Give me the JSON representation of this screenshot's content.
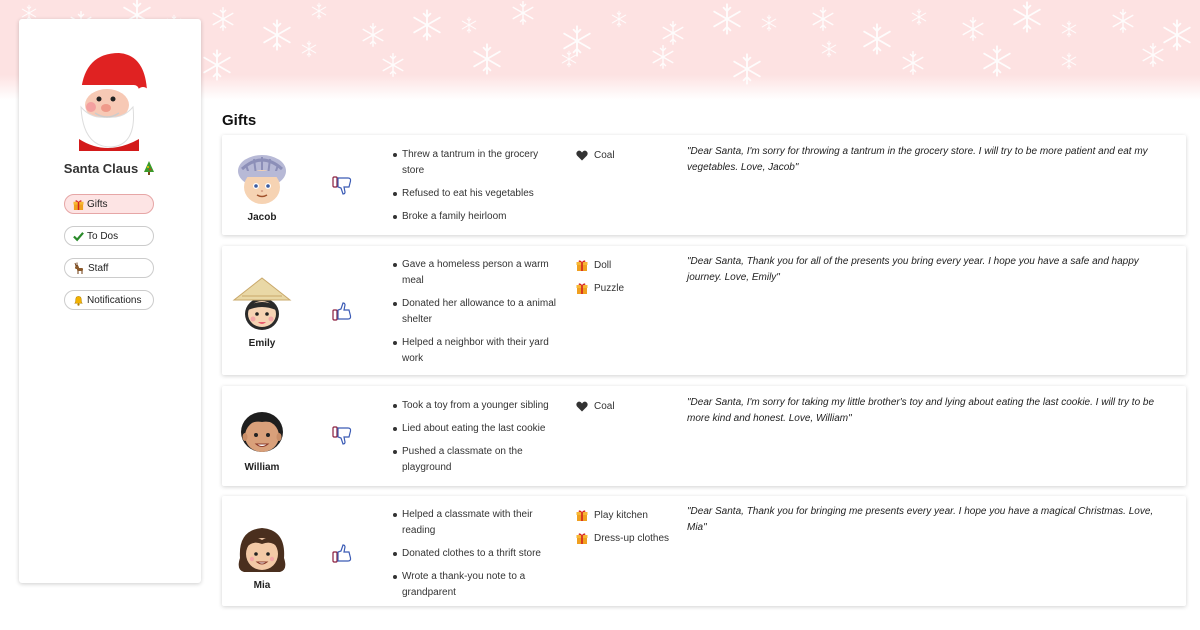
{
  "sidebar": {
    "profile_name": "Santa Claus",
    "avatar": "santa-avatar",
    "nav": [
      {
        "label": "Gifts",
        "icon": "gift-icon",
        "active": true
      },
      {
        "label": "To Dos",
        "icon": "check-icon",
        "active": false
      },
      {
        "label": "Staff",
        "icon": "reindeer-icon",
        "active": false
      },
      {
        "label": "Notifications",
        "icon": "bell-icon",
        "active": false
      }
    ]
  },
  "main": {
    "title": "Gifts",
    "children": [
      {
        "name": "Jacob",
        "rating": "thumbs-down",
        "deeds": [
          "Threw a tantrum in the grocery store",
          "Refused to eat his vegetables",
          "Broke a family heirloom"
        ],
        "gifts": [
          {
            "label": "Coal",
            "icon": "heart-icon"
          }
        ],
        "letter": "\"Dear Santa, I'm sorry for throwing a tantrum in the grocery store. I will try to be more patient and eat my vegetables. Love, Jacob\""
      },
      {
        "name": "Emily",
        "rating": "thumbs-up",
        "deeds": [
          "Gave a homeless person a warm meal",
          "Donated her allowance to a animal shelter",
          "Helped a neighbor with their yard work"
        ],
        "gifts": [
          {
            "label": "Doll",
            "icon": "gift-icon"
          },
          {
            "label": "Puzzle",
            "icon": "gift-icon"
          }
        ],
        "letter": "\"Dear Santa, Thank you for all of the presents you bring every year. I hope you have a safe and happy journey. Love, Emily\""
      },
      {
        "name": "William",
        "rating": "thumbs-down",
        "deeds": [
          "Took a toy from a younger sibling",
          "Lied about eating the last cookie",
          "Pushed a classmate on the playground"
        ],
        "gifts": [
          {
            "label": "Coal",
            "icon": "heart-icon"
          }
        ],
        "letter": "\"Dear Santa, I'm sorry for taking my little brother's toy and lying about eating the last cookie. I will try to be more kind and honest. Love, William\""
      },
      {
        "name": "Mia",
        "rating": "thumbs-up",
        "deeds": [
          "Helped a classmate with their reading",
          "Donated clothes to a thrift store",
          "Wrote a thank-you note to a grandparent"
        ],
        "gifts": [
          {
            "label": "Play kitchen",
            "icon": "gift-icon"
          },
          {
            "label": "Dress-up clothes",
            "icon": "gift-icon"
          }
        ],
        "letter": "\"Dear Santa, Thank you for bringing me presents every year. I hope you have a magical Christmas. Love, Mia\""
      }
    ]
  },
  "colors": {
    "banner": "#fde2e2",
    "active_nav_bg": "#fde4e4",
    "gift_orange": "#f0a020",
    "thumb_outline": "#8a1c3c"
  }
}
